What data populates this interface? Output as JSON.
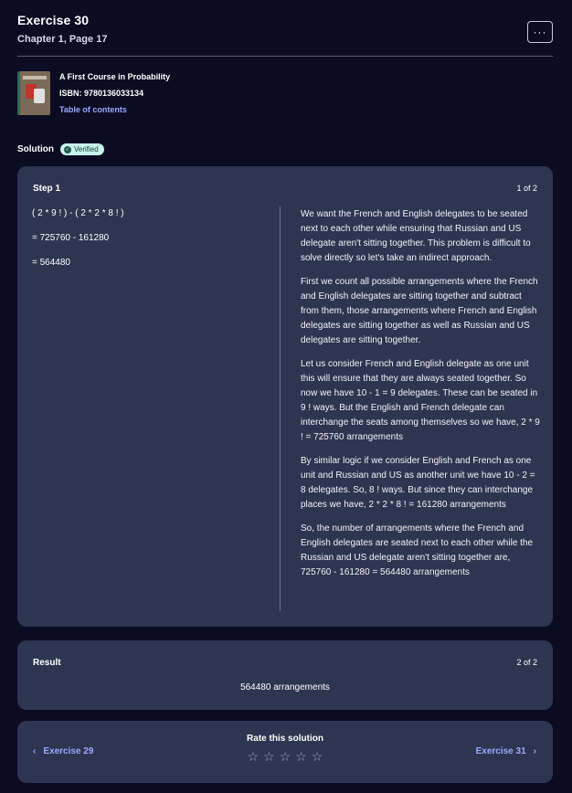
{
  "header": {
    "title": "Exercise 30",
    "subtitle": "Chapter 1, Page 17",
    "more_label": "···"
  },
  "book": {
    "title": "A First Course in Probability",
    "isbn": "ISBN: 9780136033134",
    "toc_label": "Table of contents"
  },
  "solution": {
    "label": "Solution",
    "badge": "Verified"
  },
  "step": {
    "label": "Step 1",
    "count": "1 of 2",
    "math": [
      "( 2 * 9 ! ) - ( 2 * 2 * 8 ! )",
      "= 725760 - 161280",
      "= 564480"
    ],
    "paragraphs": [
      "We want the French and English delegates to be seated next to each other while ensuring that Russian and US delegate aren't sitting together. This problem is difficult to solve directly so let's take an indirect approach.",
      "First we count all possible arrangements where the French and English delegates are sitting together and subtract from them, those arrangements where French and English delegates are sitting together as well as Russian and US delegates are sitting together.",
      "Let us consider French and English delegate as one unit this will ensure that they are always seated together. So now we have 10 - 1 = 9 delegates. These can be seated in 9 ! ways. But the English and French delegate can interchange the seats among themselves so we have, 2 * 9 ! = 725760 arrangements",
      "By similar logic if we consider English and French as one unit and Russian and US as another unit we have 10 - 2 = 8 delegates. So, 8 ! ways. But since they can interchange places we have, 2 * 2 * 8 ! = 161280 arrangements",
      "So, the number of arrangements where the French and English delegates are seated next to each other while the Russian and US delegate aren't sitting together are, 725760 - 161280 = 564480 arrangements"
    ]
  },
  "result": {
    "label": "Result",
    "count": "2 of 2",
    "value": "564480 arrangements"
  },
  "nav": {
    "prev_label": "Exercise 29",
    "next_label": "Exercise 31",
    "rate_label": "Rate this solution",
    "stars_total": 5,
    "stars_selected": 0
  },
  "icons": {
    "more": "more-horizontal-icon",
    "verified": "check-badge-icon",
    "prev": "chevron-left-icon",
    "next": "chevron-right-icon",
    "star": "star-outline-icon"
  }
}
